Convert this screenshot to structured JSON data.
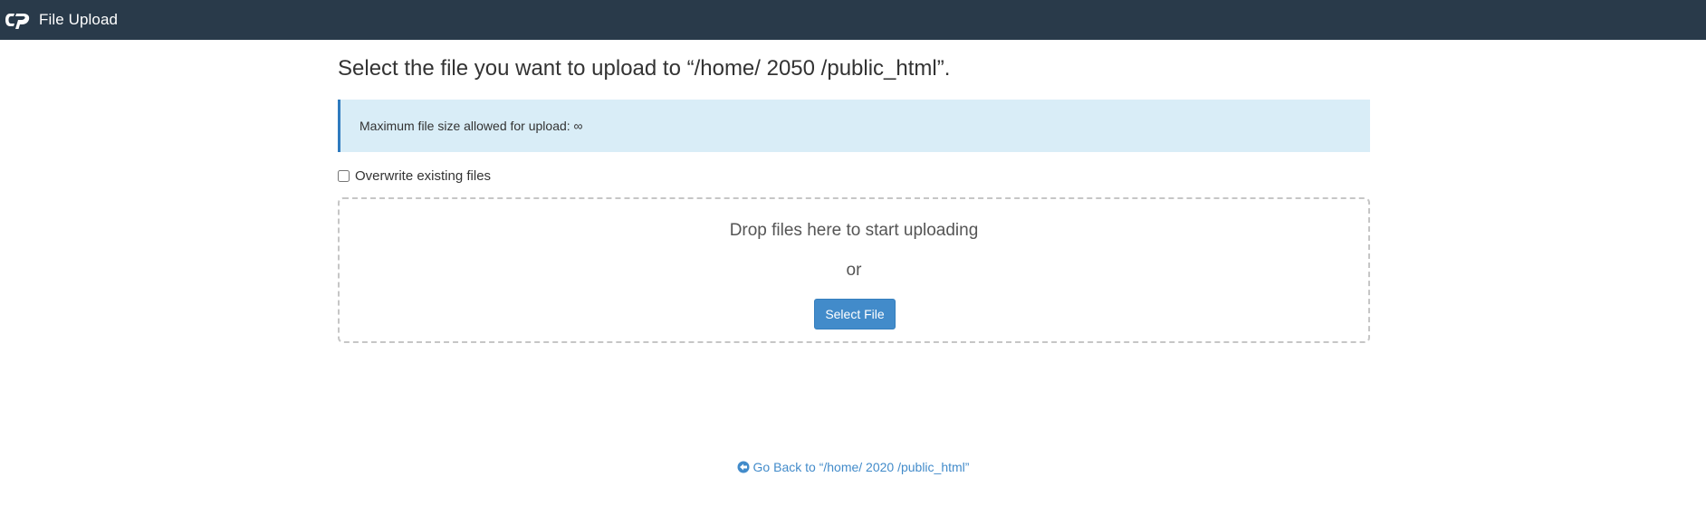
{
  "app": {
    "title": "File Upload",
    "logo_icon": "cpanel-logo-icon"
  },
  "main": {
    "heading": "Select the file you want to upload to “/home/ 2050 /public_html”.",
    "alert_text": "Maximum file size allowed for upload: ∞",
    "overwrite_label": "Overwrite existing files",
    "overwrite_checked": false,
    "dropzone": {
      "drop_text": "Drop files here to start uploading",
      "or_text": "or",
      "select_button": "Select File"
    },
    "go_back": {
      "icon": "arrow-circle-left-icon",
      "label": "Go Back to “/home/ 2020 /public_html”"
    }
  },
  "colors": {
    "topbar": "#293a4a",
    "alert_bg": "#d9edf7",
    "alert_border": "#2f7bbf",
    "primary": "#428bca"
  }
}
